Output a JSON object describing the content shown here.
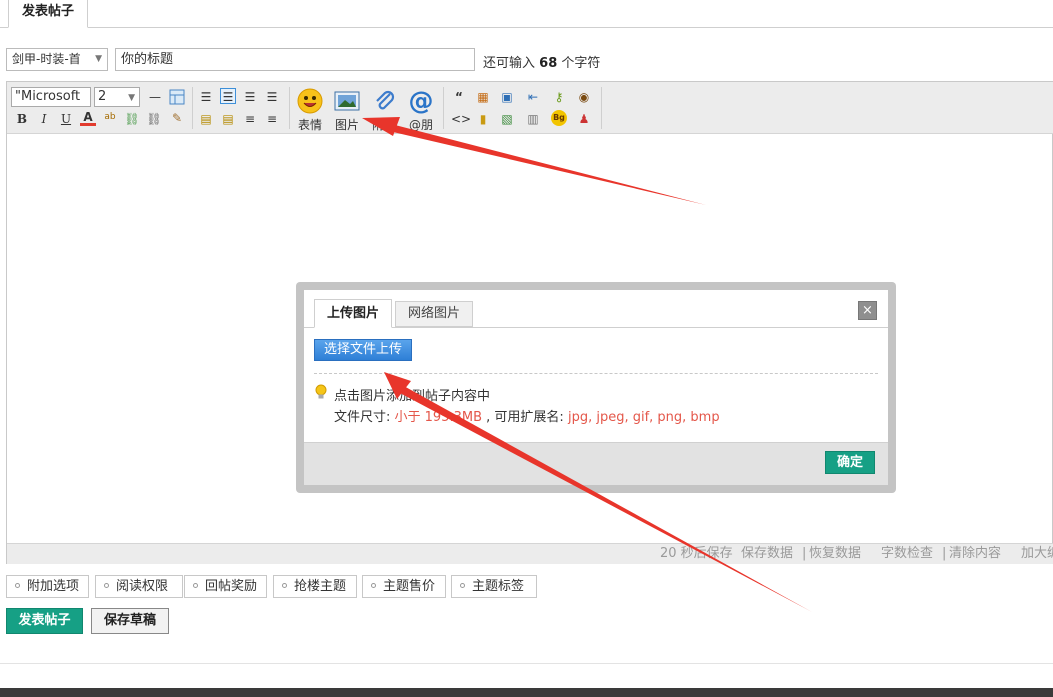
{
  "top_tab": {
    "label": "发表帖子"
  },
  "title_row": {
    "category": "剑甲-时装-首",
    "title_value": "你的标题",
    "remain_prefix": "还可输入",
    "remain_count": "68",
    "remain_suffix": "个字符"
  },
  "toolbar": {
    "font_family": "\"Microsoft",
    "font_size": "2",
    "emoji_label": "表情",
    "image_label": "图片",
    "attach_label": "附件",
    "at_label": "@朋"
  },
  "status_bar": {
    "autosave": "20 秒后保存",
    "save_data": "保存数据",
    "restore_data": "恢复数据",
    "word_check": "字数检查",
    "clear_content": "清除内容",
    "enlarge": "加大编辑框"
  },
  "options": [
    {
      "label": "附加选项"
    },
    {
      "label": "阅读权限"
    },
    {
      "label": "回帖奖励"
    },
    {
      "label": "抢楼主题"
    },
    {
      "label": "主题售价"
    },
    {
      "label": "主题标签"
    }
  ],
  "actions": {
    "publish": "发表帖子",
    "draft": "保存草稿"
  },
  "dialog": {
    "tab_upload": "上传图片",
    "tab_web": "网络图片",
    "close": "×",
    "choose_button": "选择文件上传",
    "tip_line1": "点击图片添加到帖子内容中",
    "size_prefix": "文件尺寸:",
    "size_value": "小于 195.3MB",
    "ext_prefix": ", 可用扩展名:",
    "ext_value": "jpg, jpeg, gif, png, bmp",
    "ok": "确定"
  },
  "colors": {
    "accent_green": "#16a085",
    "choose_blue": "#2e7fd6",
    "annotation_red": "#e8352b",
    "tip_red": "#e4574a"
  }
}
